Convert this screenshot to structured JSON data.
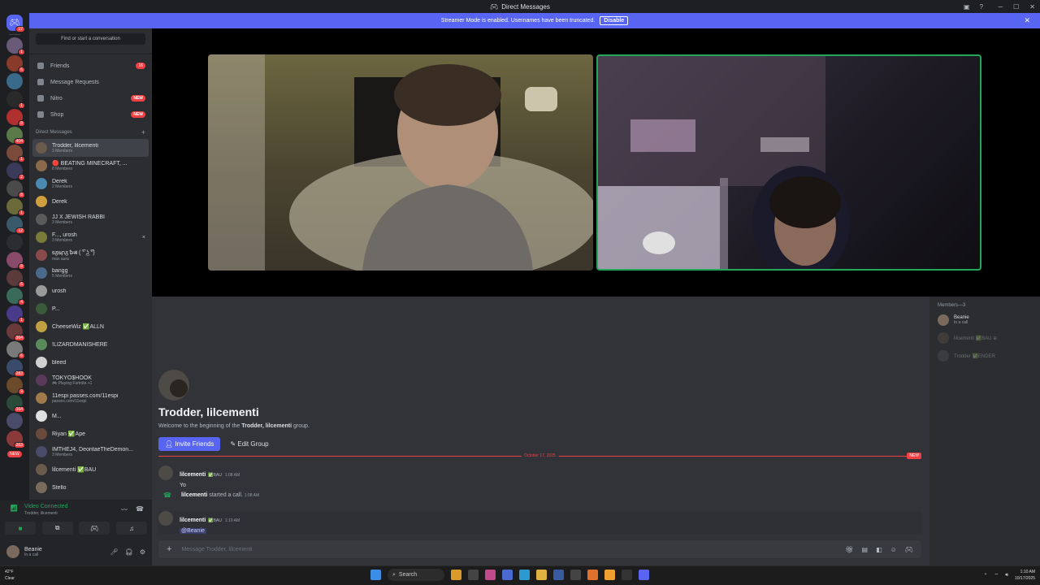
{
  "titlebar": {
    "title": "Direct Messages"
  },
  "banner": {
    "text": "Streamer Mode is enabled. Usernames have been truncated.",
    "button": "Disable"
  },
  "rail": {
    "servers": [
      {
        "color": "#5865f2",
        "badge": "17",
        "home": true
      },
      {
        "color": "#6a5a7a",
        "badge": "1"
      },
      {
        "color": "#8a3a2a",
        "badge": "6"
      },
      {
        "color": "#3a6a8a",
        "badge": ""
      },
      {
        "color": "#2a2a2a",
        "badge": "1"
      },
      {
        "color": "#b03030",
        "badge": "8"
      },
      {
        "color": "#5a7a4a",
        "badge": "404"
      },
      {
        "color": "#7a4a3a",
        "badge": "1"
      },
      {
        "color": "#3a3a5a",
        "badge": "2"
      },
      {
        "color": "#4a4a4a",
        "badge": "8"
      },
      {
        "color": "#6a6a3a",
        "badge": "1"
      },
      {
        "color": "#3a5a6a",
        "badge": "12"
      },
      {
        "color": "#2b2d31",
        "badge": ""
      },
      {
        "color": "#8a4a6a",
        "badge": "8"
      },
      {
        "color": "#5a3a3a",
        "badge": "6"
      },
      {
        "color": "#3a6a5a",
        "badge": "4"
      },
      {
        "color": "#4a3a8a",
        "badge": "1"
      },
      {
        "color": "#6a3a3a",
        "badge": "364"
      },
      {
        "color": "#7a7a7a",
        "badge": "6"
      },
      {
        "color": "#3a4a6a",
        "badge": "283"
      },
      {
        "color": "#6a4a2a",
        "badge": "9"
      },
      {
        "color": "#2a4a3a",
        "badge": "164"
      },
      {
        "color": "#4a4a6a",
        "badge": ""
      },
      {
        "color": "#8a3a3a",
        "badge": "263"
      }
    ],
    "new_label": "NEW"
  },
  "sidebar": {
    "search_placeholder": "Find or start a conversation",
    "nav": [
      {
        "label": "Friends",
        "count": "16",
        "pill": ""
      },
      {
        "label": "Message Requests",
        "count": "",
        "pill": ""
      },
      {
        "label": "Nitro",
        "count": "",
        "pill": "NEW"
      },
      {
        "label": "Shop",
        "count": "",
        "pill": "NEW"
      }
    ],
    "dm_header": "Direct Messages",
    "dms": [
      {
        "name": "Trodder, lilcementi",
        "sub": "3 Members",
        "color": "#6a5a4c",
        "active": true
      },
      {
        "name": "🔴 BEATING MINECRAFT, ...",
        "sub": "8 Members",
        "color": "#8a6a4a"
      },
      {
        "name": "Derek",
        "sub": "2 Members",
        "color": "#4a8ab0"
      },
      {
        "name": "Derek",
        "sub": "",
        "color": "#d0a040"
      },
      {
        "name": "JJ X JEWISH RABBI",
        "sub": "3 Members",
        "color": "#5a5a5a"
      },
      {
        "name": "F..., urosh",
        "sub": "3 Members",
        "color": "#7a7a3a",
        "x": "×"
      },
      {
        "name": "ᵴᵹᴓꞃᵹ ᵬ̶ꝛᵵ ( ͡° ͜ʖ ͡°)",
        "sub": "max aura",
        "color": "#8a4a4a"
      },
      {
        "name": "bangg",
        "sub": "5 Members",
        "color": "#4a6a8a"
      },
      {
        "name": "urosh",
        "sub": "",
        "color": "#9a9a9a"
      },
      {
        "name": "P...",
        "sub": "",
        "color": "#3a5a3a"
      },
      {
        "name": "CheeseWiz ✅ALLN",
        "sub": "",
        "color": "#c0a040"
      },
      {
        "name": "!LIZARDMANISHERE",
        "sub": "",
        "color": "#5a8a5a"
      },
      {
        "name": "bleed",
        "sub": "",
        "color": "#d0d0d0"
      },
      {
        "name": "TOKYO$HOOK",
        "sub": "🎮 Playing Fortnite +1",
        "color": "#5a3a5a"
      },
      {
        "name": "11espi passes.com/11espi",
        "sub": "passes.com/11espi",
        "color": "#a07a4a"
      },
      {
        "name": "M...",
        "sub": "",
        "color": "#e0e0e0"
      },
      {
        "name": "Riyan ✅Ape",
        "sub": "",
        "color": "#6a4a3a"
      },
      {
        "name": "IMTHEJ4, DeontaeTheDemon...",
        "sub": "3 Members",
        "color": "#4a4a6a"
      },
      {
        "name": "lilcementi ✅BAU",
        "sub": "",
        "color": "#6a5a4c"
      },
      {
        "name": "Stello",
        "sub": "",
        "color": "#7a6a5a"
      }
    ]
  },
  "voice": {
    "status": "Video Connected",
    "channel": "Trodder, lilcementi"
  },
  "user": {
    "name": "Beanie",
    "status": "In a call"
  },
  "members": {
    "header": "Members—3",
    "list": [
      {
        "name": "Beanie",
        "sub": "In a call",
        "dim": false,
        "color": "#7a6a5d"
      },
      {
        "name": "lilcementi ✅BAU ⊕",
        "sub": "",
        "dim": true,
        "color": "#6a5a4c"
      },
      {
        "name": "Trodder ✅ENDER",
        "sub": "",
        "dim": true,
        "color": "#5a5a5a"
      }
    ]
  },
  "welcome": {
    "title": "Trodder, lilcementi",
    "sub_prefix": "Welcome to the beginning of the ",
    "sub_bold": "Trodder, lilcementi",
    "sub_suffix": " group.",
    "invite": "Invite Friends",
    "edit": "Edit Group"
  },
  "divider": {
    "date": "October 17, 2025",
    "new": "NEW"
  },
  "messages": [
    {
      "name": "lilcementi",
      "tag": "✅BAU",
      "time": "1:08 AM",
      "text": "Yo"
    },
    {
      "name": "lilcementi",
      "tag": "✅BAU",
      "time": "1:10 AM",
      "text": "@Beanie"
    }
  ],
  "system": {
    "name": "lilcementi",
    "action": " started a call.",
    "time": "1:08 AM"
  },
  "composer": {
    "placeholder": "Message Trodder, lilcementi"
  },
  "taskbar": {
    "weather_temp": "42°F",
    "weather_desc": "Clear",
    "search": "Search",
    "time": "1:10 AM",
    "date": "10/17/2025"
  }
}
